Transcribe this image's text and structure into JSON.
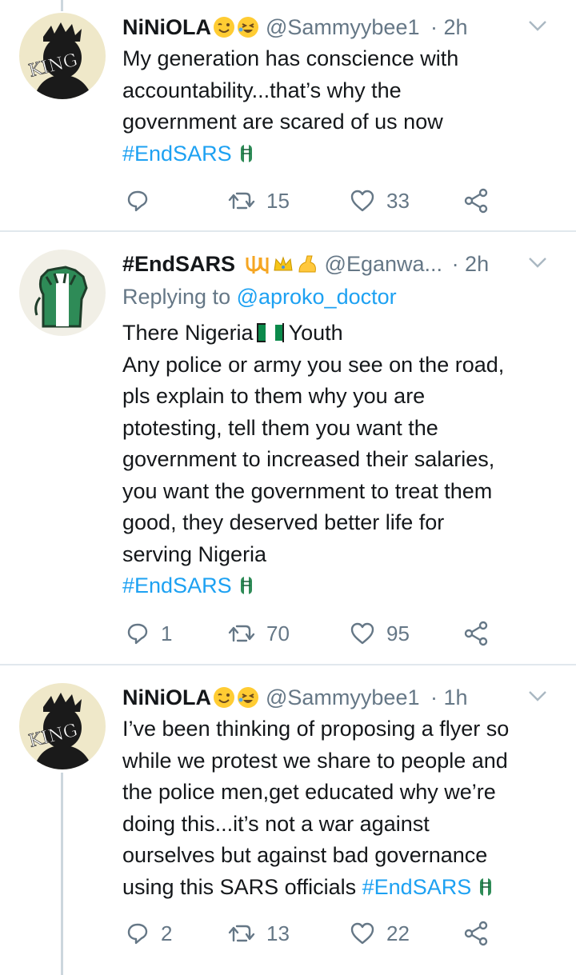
{
  "tweets": [
    {
      "name": "NiNiOLA",
      "handle": "@Sammyybee1",
      "time": "· 2h",
      "reply_prefix": "",
      "reply_mention": "",
      "body": "My generation has conscience with\naccountability...that’s why the\ngovernment are scared of us now",
      "hashtag": "#EndSARS",
      "replies": "",
      "retweets": "15",
      "likes": "33",
      "avatar_text": "KING"
    },
    {
      "name": "#EndSARS",
      "handle": "@Eganwa...",
      "time": "· 2h",
      "reply_prefix": "Replying to ",
      "reply_mention": "@aproko_doctor",
      "body_first_a": "There Nigeria",
      "body_first_b": "Youth",
      "body": "Any police or army you see on the road,\npls explain to them why you are\nptotesting, tell them you want the\ngovernment to increased their salaries,\nyou want the government to treat them\ngood, they deserved better life for\nserving Nigeria",
      "hashtag": "#EndSARS",
      "replies": "1",
      "retweets": "70",
      "likes": "95"
    },
    {
      "name": "NiNiOLA",
      "handle": "@Sammyybee1",
      "time": "· 1h",
      "body": "I’ve been thinking of proposing a flyer so\nwhile we protest we share to people and\nthe police men,get educated why we’re\ndoing this...it’s not a war against\nourselves but against bad governance\nusing this SARS officials ",
      "hashtag": "#EndSARS",
      "replies": "2",
      "retweets": "13",
      "likes": "22",
      "avatar_text": "KING"
    }
  ],
  "colors": {
    "accent": "#1da1f2",
    "muted": "#657786",
    "divider": "#e1e8ed",
    "green": "#2e8b57"
  },
  "icons": [
    "reply-icon",
    "retweet-icon",
    "like-icon",
    "share-icon",
    "chevron-down-icon",
    "fist-emoji",
    "nigeria-flag-emoji",
    "wink-emoji",
    "laugh-emoji"
  ]
}
